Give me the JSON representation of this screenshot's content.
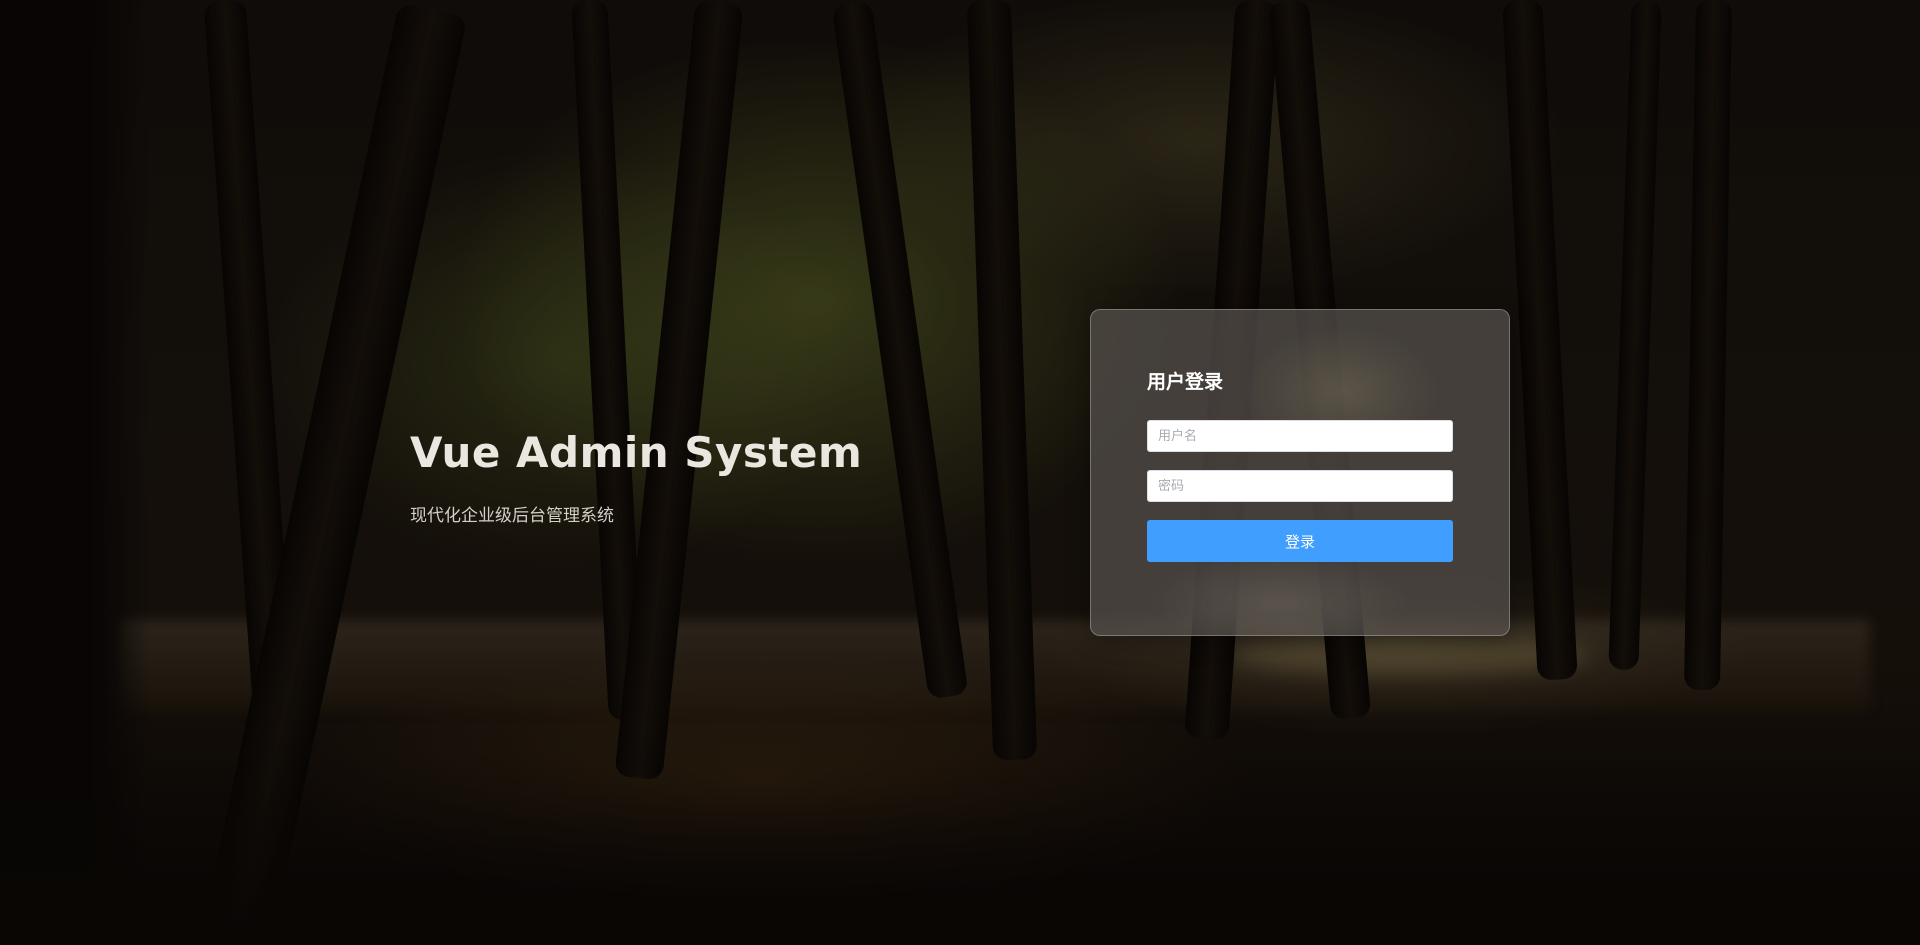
{
  "hero": {
    "title": "Vue Admin System",
    "subtitle": "现代化企业级后台管理系统"
  },
  "login": {
    "title": "用户登录",
    "username": {
      "placeholder": "用户名",
      "value": ""
    },
    "password": {
      "placeholder": "密码",
      "value": ""
    },
    "submit_label": "登录"
  },
  "colors": {
    "accent": "#409eff",
    "card_background": "#58524e",
    "text_light": "#ece6e1"
  },
  "background": {
    "description_icon": "forest-park-photo"
  }
}
